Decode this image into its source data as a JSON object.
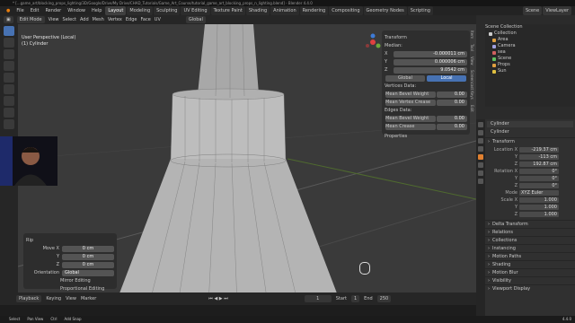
{
  "title": "* [...game_art/blocking_props_lighting/3D/Google/Drive/My Drive/CHAD_Tutorials/Game_Art_Course/tutorial_game_art_blocking_props_n_lighting.blend] - Blender 4.4.0",
  "menu": [
    "File",
    "Edit",
    "Render",
    "Window",
    "Help"
  ],
  "workspaces": [
    "Layout",
    "Modeling",
    "Sculpting",
    "UV Editing",
    "Texture Paint",
    "Shading",
    "Animation",
    "Rendering",
    "Compositing",
    "Geometry Nodes",
    "Scripting"
  ],
  "scene": "Scene",
  "view_layer": "ViewLayer",
  "header": {
    "mode": "Edit Mode",
    "view": "View",
    "select": "Select",
    "add": "Add",
    "mesh": "Mesh",
    "vertex": "Vertex",
    "edge": "Edge",
    "face": "Face",
    "uv": "UV",
    "orientation": "Global"
  },
  "viewport": {
    "label1": "User Perspective (Local)",
    "label2": "(1) Cylinder"
  },
  "npanel": {
    "transform": "Transform",
    "median": "Median:",
    "x": "-0.000011 cm",
    "y": "0.000006 cm",
    "z": "9.0542 cm",
    "global": "Global",
    "local": "Local",
    "vertices_data": "Vertices Data:",
    "mean_bevel_weight": "Mean Bevel Weight",
    "mean_bevel_weight_val": "0.00",
    "mean_vertex_crease": "Mean Vertex Crease",
    "mean_vertex_crease_val": "0.00",
    "edges_data": "Edges Data:",
    "mean_bevel_weight_e": "Mean Bevel Weight",
    "mean_bevel_weight_e_val": "0.00",
    "mean_crease": "Mean Crease",
    "mean_crease_val": "0.00",
    "properties": "Properties"
  },
  "vtabs": [
    "Item",
    "Tool",
    "View",
    "Screencast Keys",
    "Edit"
  ],
  "operator": {
    "title": "Rip",
    "move_x": "0 cm",
    "move_y": "0 cm",
    "move_z": "0 cm",
    "orientation_label": "Orientation",
    "orientation": "Global",
    "mirror": "Mirror Editing",
    "proportional": "Proportional Editing",
    "lbl_x": "Move X",
    "lbl_y": "Y",
    "lbl_z": "Z"
  },
  "outliner": {
    "header": "Scene Collection",
    "items": [
      "Collection",
      "Area",
      "Camera",
      "sea",
      "Scene",
      "Props",
      "Sun"
    ]
  },
  "props": {
    "object": "Cylinder",
    "data": "Cylinder",
    "transform": "Transform",
    "location_label": "Location X",
    "loc": [
      "-219.37 cm",
      "-113 cm",
      "192.87 cm"
    ],
    "rotation_label": "Rotation X",
    "rot": [
      "0°",
      "0°",
      "0°"
    ],
    "mode_label": "Mode",
    "mode": "XYZ Euler",
    "scale_label": "Scale X",
    "scale": [
      "1.000",
      "1.000",
      "1.000"
    ],
    "delta": "Delta Transform",
    "sections": [
      "Relations",
      "Collections",
      "Instancing",
      "Motion Paths",
      "Shading",
      "Motion Blur",
      "Visibility",
      "Viewport Display"
    ]
  },
  "timeline": {
    "playback": "Playback",
    "keying": "Keying",
    "view": "View",
    "marker": "Marker",
    "frame": "1",
    "start_label": "Start",
    "start": "1",
    "end_label": "End",
    "end": "250"
  },
  "status": [
    "Select",
    "Pan View",
    "Ctrl",
    "Add Snap"
  ],
  "version": "4.4.0"
}
